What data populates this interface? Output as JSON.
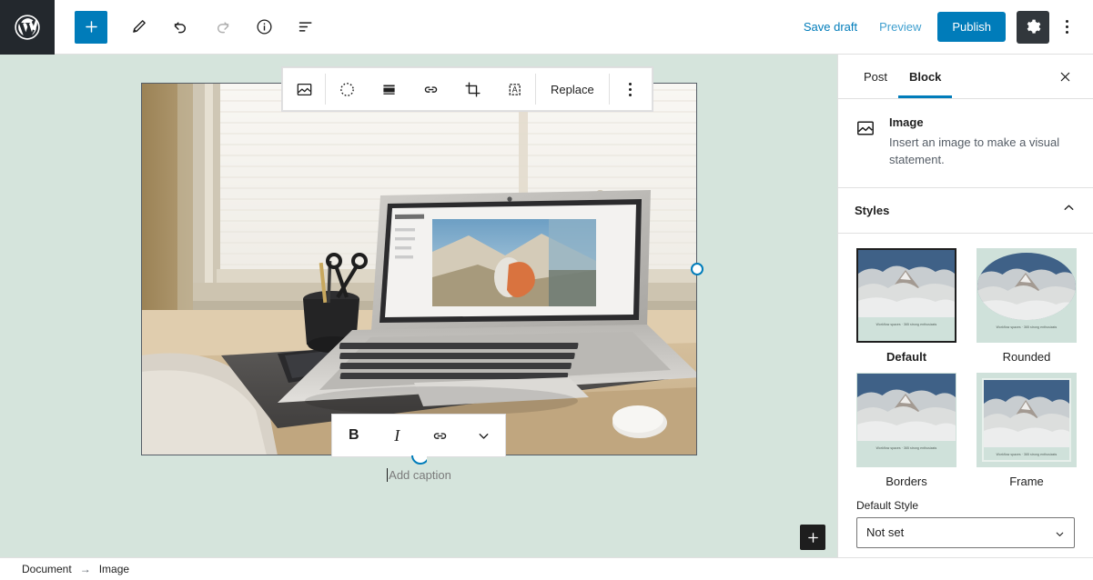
{
  "topbar": {
    "logo_icon": "wordpress-logo",
    "tools": [
      {
        "name": "add-block-button",
        "icon": "plus-icon",
        "label": "Add block",
        "state": "primary"
      },
      {
        "name": "edit-tool-button",
        "icon": "pencil-icon",
        "label": "Tools"
      },
      {
        "name": "undo-button",
        "icon": "undo-arrow-icon",
        "label": "Undo"
      },
      {
        "name": "redo-button",
        "icon": "redo-arrow-icon",
        "label": "Redo",
        "state": "disabled"
      },
      {
        "name": "details-button",
        "icon": "info-circle-icon",
        "label": "Details"
      },
      {
        "name": "list-view-button",
        "icon": "list-view-icon",
        "label": "List view"
      }
    ],
    "save_draft_label": "Save draft",
    "preview_label": "Preview",
    "publish_label": "Publish",
    "settings_icon": "gear-icon",
    "more_icon": "kebab-menu-icon",
    "accent_color": "#007cba",
    "dark_color": "#32373c"
  },
  "block_toolbar": {
    "buttons": [
      {
        "name": "block-type-image-button",
        "icon": "image-icon"
      },
      {
        "name": "drag-handle-button",
        "icon": "drag-dots-circle-icon"
      },
      {
        "name": "align-button",
        "icon": "align-icon"
      },
      {
        "name": "link-button",
        "icon": "link-icon"
      },
      {
        "name": "crop-button",
        "icon": "crop-icon"
      },
      {
        "name": "add-text-over-image-button",
        "icon": "text-over-image-icon"
      }
    ],
    "replace_label": "Replace",
    "more_icon": "kebab-menu-icon"
  },
  "canvas": {
    "background_color": "#d5e4dc",
    "image_alt": "Laptop on a wooden desk by a window with blinds, pen cup with scissors, phone and mouse",
    "caption_placeholder": "Add caption",
    "resize_handle_color": "#007cba",
    "add_block_below_icon": "plus-icon"
  },
  "format_toolbar": {
    "bold_label": "B",
    "italic_label": "I",
    "link_icon": "link-icon",
    "more_icon": "chevron-down-icon"
  },
  "sidebar": {
    "tabs": [
      {
        "label": "Post",
        "active": false
      },
      {
        "label": "Block",
        "active": true
      }
    ],
    "close_icon": "close-icon",
    "block": {
      "icon": "image-icon",
      "title": "Image",
      "description": "Insert an image to make a visual statement."
    },
    "styles_section": {
      "title": "Styles",
      "chevron_icon": "chevron-up-icon",
      "options": [
        {
          "label": "Default",
          "selected": true,
          "variant": "default",
          "thumb_caption": "Workflow spaces · 365 strong enthusiasts"
        },
        {
          "label": "Rounded",
          "selected": false,
          "variant": "rounded",
          "thumb_caption": "Workflow spaces · 365 strong enthusiasts"
        },
        {
          "label": "Borders",
          "selected": false,
          "variant": "borders",
          "thumb_caption": "Workflow spaces · 365 strong enthusiasts"
        },
        {
          "label": "Frame",
          "selected": false,
          "variant": "frame",
          "thumb_caption": "Workflow spaces · 365 strong enthusiasts"
        }
      ],
      "default_style_label": "Default Style",
      "default_style_value": "Not set",
      "default_style_options": [
        "Not set",
        "Default",
        "Rounded",
        "Borders",
        "Frame"
      ]
    }
  },
  "footer": {
    "breadcrumb": [
      "Document",
      "Image"
    ],
    "separator": "→"
  }
}
